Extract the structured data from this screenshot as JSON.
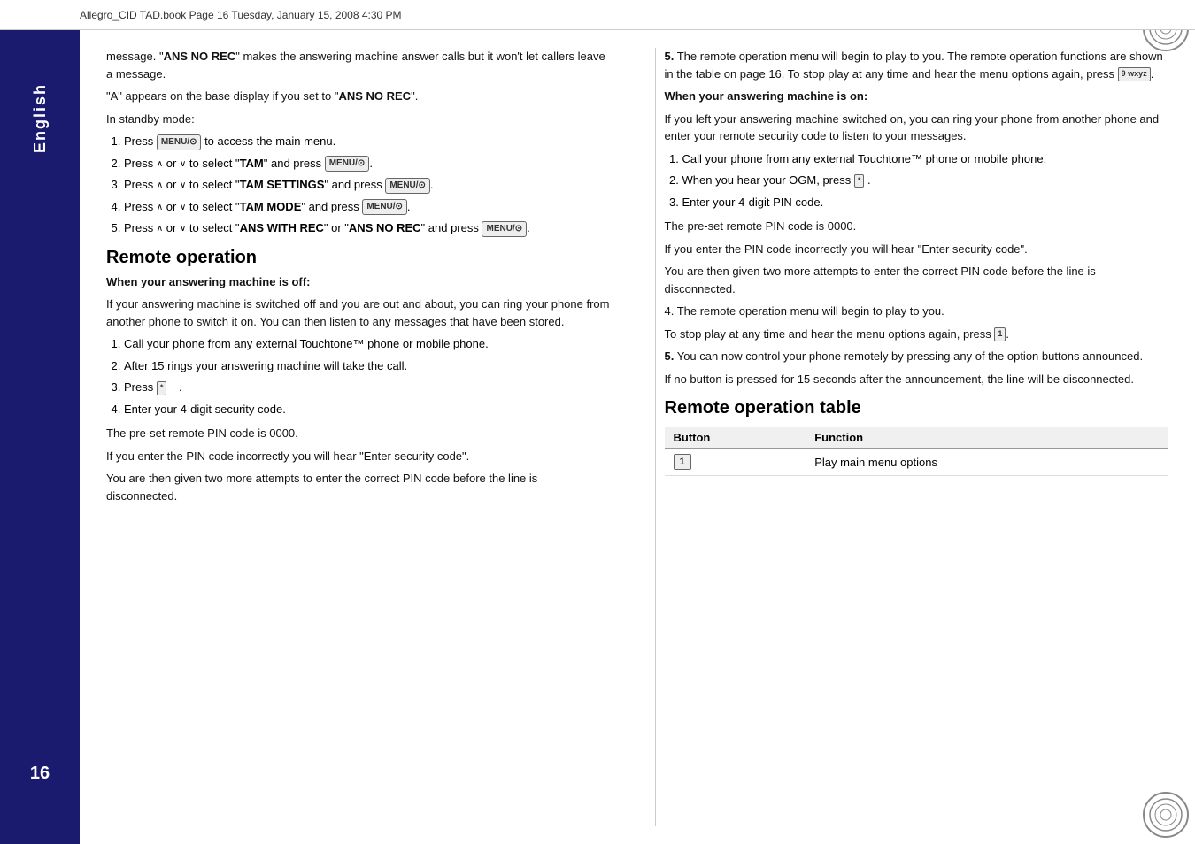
{
  "header": {
    "text": "Allegro_CID TAD.book  Page 16  Tuesday, January 15, 2008  4:30 PM"
  },
  "sidebar": {
    "language": "English",
    "page_number": "16"
  },
  "left_column": {
    "intro": {
      "p1": "message. \"ANS NO REC\" makes the answering machine answer calls but it won't let callers leave a message.",
      "p2": "\"A\" appears on the base display if you set to \"ANS NO REC\".",
      "standby": "In standby mode:"
    },
    "steps": [
      {
        "num": "1",
        "text_before": "Press",
        "button": "MENU/⊙",
        "text_after": "to access the main menu."
      },
      {
        "num": "2",
        "text_before": "Press",
        "arrow_up": "∧",
        "or": " or ",
        "arrow_down": "∨",
        "text_mid": " to select \"",
        "bold": "TAM",
        "text_mid2": "\" and press",
        "button": "MENU/⊙",
        "text_after": "."
      },
      {
        "num": "3",
        "text_before": "Press",
        "arrow_up": "∧",
        "or": " or ",
        "arrow_down": "∨",
        "text_mid": " to select \"",
        "bold": "TAM SETTINGS",
        "text_mid2": "\" and press",
        "button": "MENU/⊙",
        "text_after": "."
      },
      {
        "num": "4",
        "text_before": "Press",
        "arrow_up": "∧",
        "or": " or ",
        "arrow_down": "∨",
        "text_mid": " to select \"",
        "bold": "TAM MODE",
        "text_mid2": "\" and press",
        "button": "MENU/⊙",
        "text_after": "."
      },
      {
        "num": "5",
        "text_before": "Press",
        "arrow_up": "∧",
        "or": " or ",
        "arrow_down": "∨",
        "text_mid": " to select \"",
        "bold1": "ANS WITH REC",
        "text_mid2": "\" or \"",
        "bold2": "ANS NO REC",
        "text_mid3": "\" and press",
        "button": "MENU/⊙",
        "text_after": "."
      }
    ],
    "remote_operation": {
      "heading": "Remote operation",
      "when_off_heading": "When your answering machine is off:",
      "when_off_body": "If your answering machine is switched off and you are out and about, you can ring your phone from another phone to switch it on. You can then listen to any messages that have been stored.",
      "steps": [
        {
          "num": "1",
          "text": "Call your phone from any external Touchtone™ phone or mobile phone."
        },
        {
          "num": "2",
          "text": "After 15 rings your answering machine will take the call."
        },
        {
          "num": "3",
          "text_before": "Press",
          "button": "*",
          "text_after": "."
        },
        {
          "num": "4",
          "text": "Enter your 4-digit security code."
        }
      ],
      "pin_note": "The pre-set remote PIN code is 0000.",
      "incorrect_note": "If you enter the PIN code incorrectly you will hear \"Enter security code\".",
      "attempts_note": "You are then given two more attempts to enter the correct PIN code before the line is disconnected."
    }
  },
  "right_column": {
    "step5_intro": "5.  The remote operation menu will begin to play to you. The remote operation functions are shown in the table on page 16. To stop play at any time and hear the menu options again, press",
    "step5_button": "9 wxyz",
    "step5_end": ".",
    "when_on_heading": "When your answering machine is on:",
    "when_on_body": "If you left your answering machine switched on, you can ring your phone from another phone and enter your remote security code to listen to your messages.",
    "steps": [
      {
        "num": "1",
        "text": "Call your phone from any external Touchtone™ phone or mobile phone."
      },
      {
        "num": "2",
        "text_before": "When you hear your OGM, press",
        "button": "*",
        "text_after": "."
      },
      {
        "num": "3",
        "text": "Enter your 4-digit PIN code."
      }
    ],
    "pin_note": "The pre-set remote PIN code is 0000.",
    "incorrect_note": "If you enter the PIN code incorrectly you will hear \"Enter security code\".",
    "attempts_note": "You are then given two more attempts to enter the correct PIN code before the line is disconnected.",
    "step4": "4.  The remote operation menu will begin to play to you.",
    "to_stop": "To stop play at any time and hear the menu options again, press",
    "to_stop_button": "1",
    "to_stop_end": ".",
    "step5_control": "5.  You can now control your phone remotely by pressing any of the option buttons announced.",
    "no_button": "If no button is pressed for 15 seconds after the announcement, the line will be disconnected.",
    "table_heading": "Remote operation table",
    "table": {
      "headers": [
        "Button",
        "Function"
      ],
      "rows": [
        {
          "button": "1",
          "function": "Play main menu options"
        }
      ]
    }
  }
}
